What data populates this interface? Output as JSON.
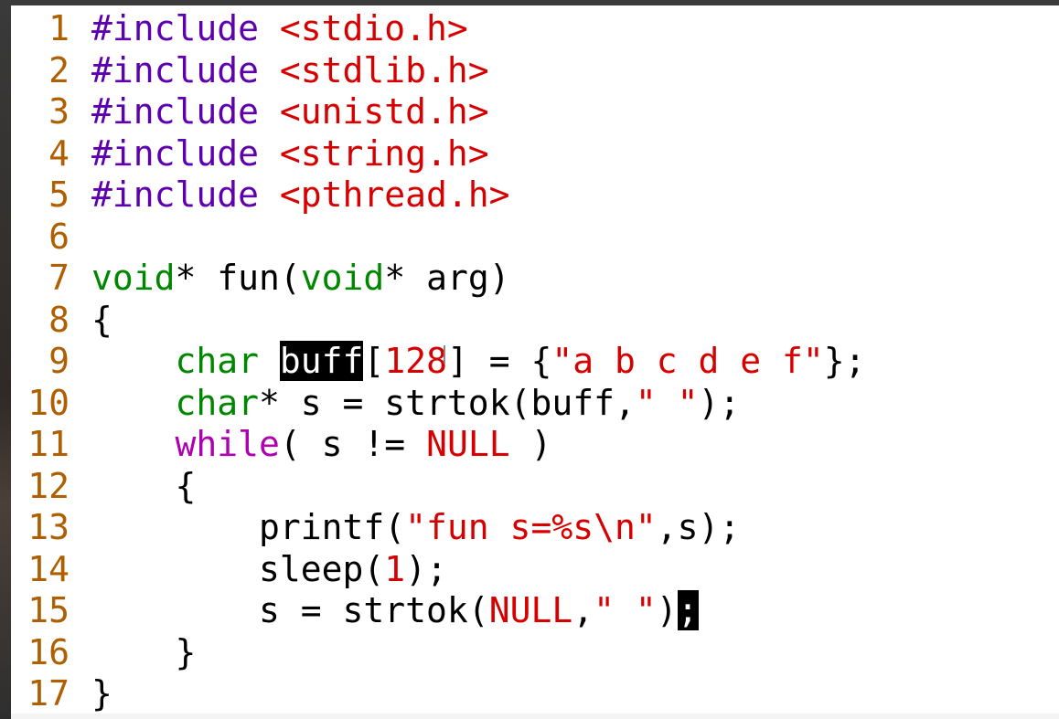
{
  "editor": {
    "lines": [
      {
        "n": "1",
        "segs": [
          [
            "kw-pre",
            "#include "
          ],
          [
            "str",
            "<stdio.h>"
          ]
        ]
      },
      {
        "n": "2",
        "segs": [
          [
            "kw-pre",
            "#include "
          ],
          [
            "str",
            "<stdlib.h>"
          ]
        ]
      },
      {
        "n": "3",
        "segs": [
          [
            "kw-pre",
            "#include "
          ],
          [
            "str",
            "<unistd.h>"
          ]
        ]
      },
      {
        "n": "4",
        "segs": [
          [
            "kw-pre",
            "#include "
          ],
          [
            "str",
            "<string.h>"
          ]
        ]
      },
      {
        "n": "5",
        "segs": [
          [
            "kw-pre",
            "#include "
          ],
          [
            "str",
            "<pthread.h>"
          ]
        ]
      },
      {
        "n": "6",
        "segs": []
      },
      {
        "n": "7",
        "segs": [
          [
            "kw-type",
            "void"
          ],
          [
            "plain",
            "* fun("
          ],
          [
            "kw-type",
            "void"
          ],
          [
            "plain",
            "* arg)"
          ]
        ]
      },
      {
        "n": "8",
        "segs": [
          [
            "plain",
            "{"
          ]
        ]
      },
      {
        "n": "9",
        "segs": [
          [
            "plain",
            "    "
          ],
          [
            "kw-type",
            "char"
          ],
          [
            "plain",
            " "
          ],
          [
            "hl",
            "buff"
          ],
          [
            "plain",
            "["
          ],
          [
            "num",
            "128"
          ],
          [
            "plain",
            "] = {"
          ],
          [
            "str",
            "\"a b c d e f\""
          ],
          [
            "plain",
            "};"
          ]
        ]
      },
      {
        "n": "10",
        "segs": [
          [
            "plain",
            "    "
          ],
          [
            "kw-type",
            "char"
          ],
          [
            "plain",
            "* s = strtok(buff,"
          ],
          [
            "str",
            "\" \""
          ],
          [
            "plain",
            ");"
          ]
        ]
      },
      {
        "n": "11",
        "segs": [
          [
            "plain",
            "    "
          ],
          [
            "kw-ctl",
            "while"
          ],
          [
            "plain",
            "( s != "
          ],
          [
            "const",
            "NULL"
          ],
          [
            "plain",
            " )"
          ]
        ]
      },
      {
        "n": "12",
        "segs": [
          [
            "plain",
            "    {"
          ]
        ]
      },
      {
        "n": "13",
        "segs": [
          [
            "plain",
            "        printf("
          ],
          [
            "str",
            "\"fun s=%s\\n\""
          ],
          [
            "plain",
            ",s);"
          ]
        ]
      },
      {
        "n": "14",
        "segs": [
          [
            "plain",
            "        sleep("
          ],
          [
            "num",
            "1"
          ],
          [
            "plain",
            ");"
          ]
        ]
      },
      {
        "n": "15",
        "segs": [
          [
            "plain",
            "        s = strtok("
          ],
          [
            "const",
            "NULL"
          ],
          [
            "plain",
            ","
          ],
          [
            "str",
            "\" \""
          ],
          [
            "plain",
            ")"
          ],
          [
            "cursor",
            ";"
          ]
        ]
      },
      {
        "n": "16",
        "segs": [
          [
            "plain",
            "    }"
          ]
        ]
      },
      {
        "n": "17",
        "segs": [
          [
            "plain",
            "}"
          ]
        ]
      }
    ],
    "colors": {
      "line_number": "#af5f00",
      "preprocessor": "#5f00af",
      "type": "#008700",
      "control": "#af00af",
      "string": "#d70000",
      "background": "#ffffff"
    }
  }
}
